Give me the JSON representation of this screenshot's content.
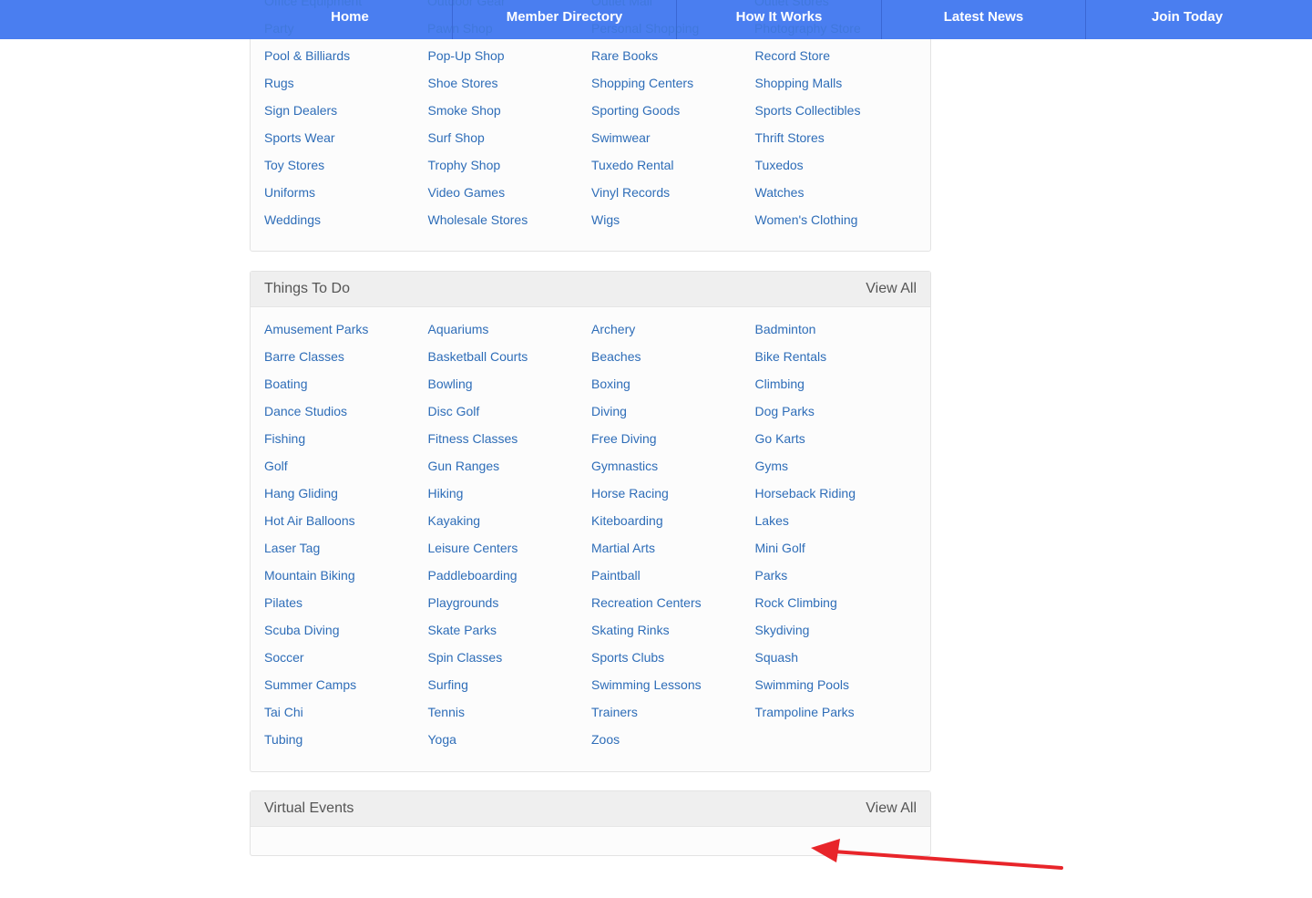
{
  "nav": {
    "items": [
      "Home",
      "Member Directory",
      "How It Works",
      "Latest News",
      "Join Today"
    ]
  },
  "shopping": {
    "partial_rows": [
      [
        "Office Equipment",
        "Outdoor Gear",
        "Outlet Mall",
        "Outlet Stores"
      ],
      [
        "Party",
        "Pawn Shop",
        "Personal Shopping",
        "Photography Store"
      ]
    ],
    "links": [
      "Pool & Billiards",
      "Pop-Up Shop",
      "Rare Books",
      "Record Store",
      "Rugs",
      "Shoe Stores",
      "Shopping Centers",
      "Shopping Malls",
      "Sign Dealers",
      "Smoke Shop",
      "Sporting Goods",
      "Sports Collectibles",
      "Sports Wear",
      "Surf Shop",
      "Swimwear",
      "Thrift Stores",
      "Toy Stores",
      "Trophy Shop",
      "Tuxedo Rental",
      "Tuxedos",
      "Uniforms",
      "Video Games",
      "Vinyl Records",
      "Watches",
      "Weddings",
      "Wholesale Stores",
      "Wigs",
      "Women's Clothing"
    ]
  },
  "things_to_do": {
    "title": "Things To Do",
    "view_all": "View All",
    "links": [
      "Amusement Parks",
      "Aquariums",
      "Archery",
      "Badminton",
      "Barre Classes",
      "Basketball Courts",
      "Beaches",
      "Bike Rentals",
      "Boating",
      "Bowling",
      "Boxing",
      "Climbing",
      "Dance Studios",
      "Disc Golf",
      "Diving",
      "Dog Parks",
      "Fishing",
      "Fitness Classes",
      "Free Diving",
      "Go Karts",
      "Golf",
      "Gun Ranges",
      "Gymnastics",
      "Gyms",
      "Hang Gliding",
      "Hiking",
      "Horse Racing",
      "Horseback Riding",
      "Hot Air Balloons",
      "Kayaking",
      "Kiteboarding",
      "Lakes",
      "Laser Tag",
      "Leisure Centers",
      "Martial Arts",
      "Mini Golf",
      "Mountain Biking",
      "Paddleboarding",
      "Paintball",
      "Parks",
      "Pilates",
      "Playgrounds",
      "Recreation Centers",
      "Rock Climbing",
      "Scuba Diving",
      "Skate Parks",
      "Skating Rinks",
      "Skydiving",
      "Soccer",
      "Spin Classes",
      "Sports Clubs",
      "Squash",
      "Summer Camps",
      "Surfing",
      "Swimming Lessons",
      "Swimming Pools",
      "Tai Chi",
      "Tennis",
      "Trainers",
      "Trampoline Parks",
      "Tubing",
      "Yoga",
      "Zoos"
    ]
  },
  "virtual_events": {
    "title": "Virtual Events",
    "view_all": "View All"
  },
  "colors": {
    "nav_bg": "#4a7ef0",
    "link": "#2e6db8",
    "panel_header_bg": "#efefef",
    "annotation": "#e8252a"
  }
}
